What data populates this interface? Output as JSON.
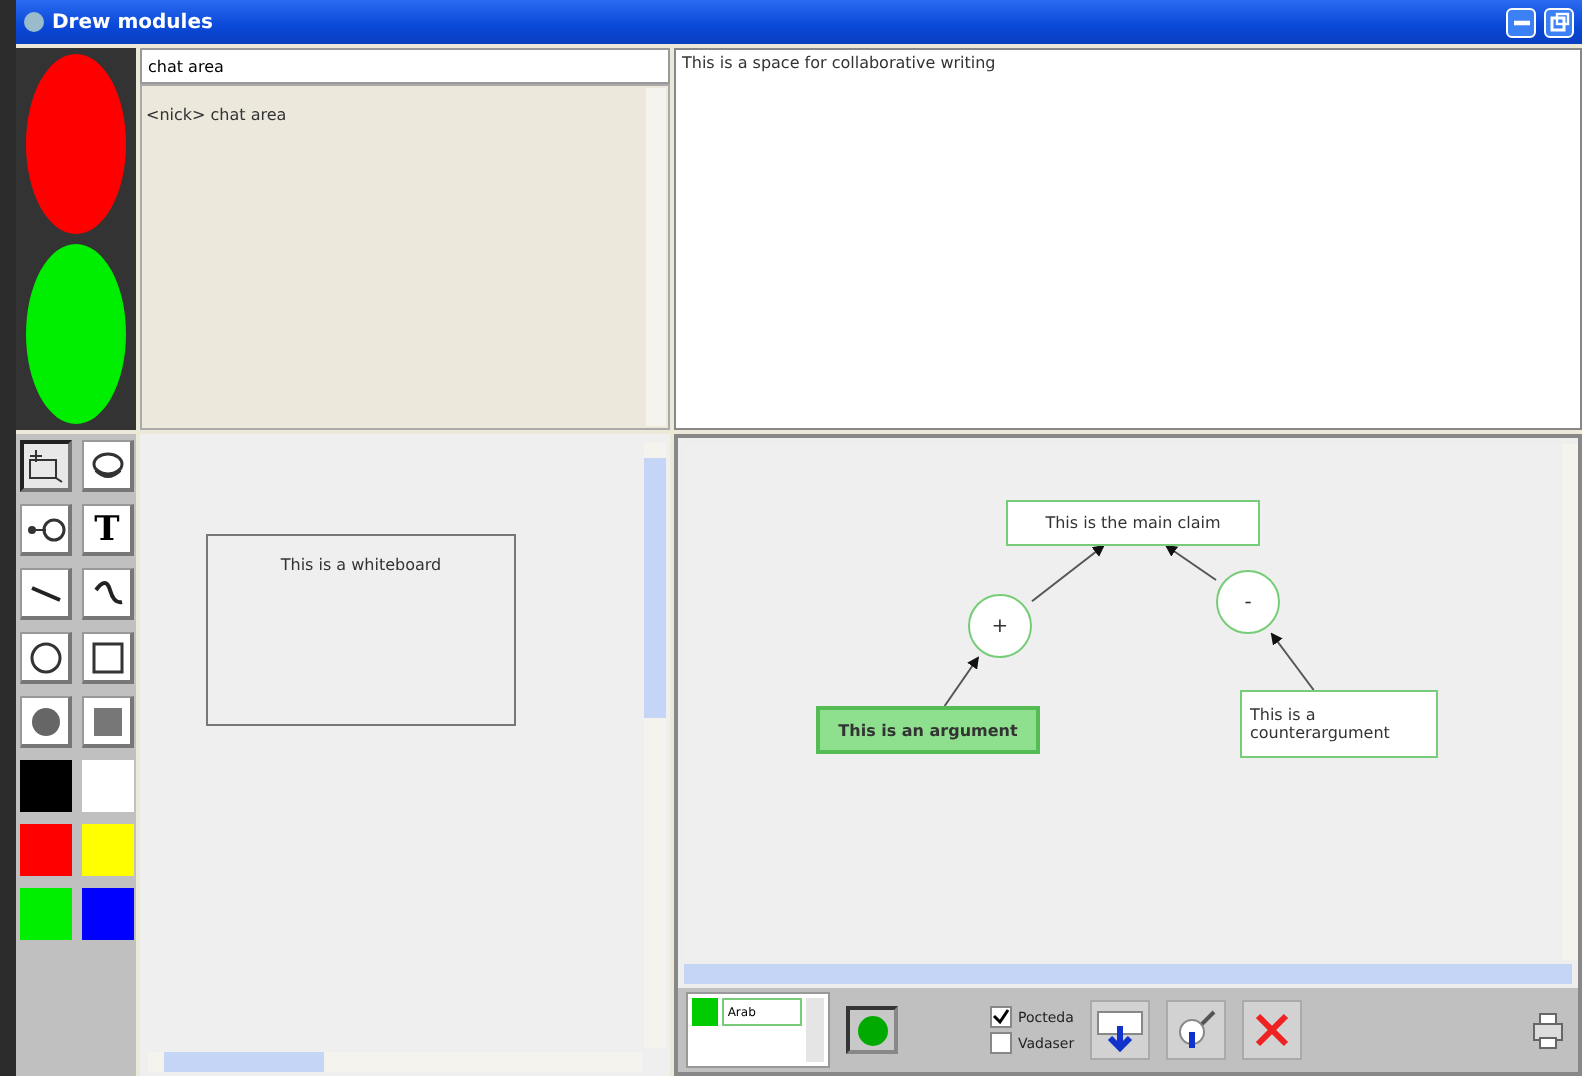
{
  "window": {
    "title": "Drew modules"
  },
  "status_lights": [
    {
      "color": "#ff0000"
    },
    {
      "color": "#00ee00"
    }
  ],
  "chat": {
    "input": "chat area",
    "log": "<nick> chat area"
  },
  "writing": {
    "text": "This is a space for collaborative writing"
  },
  "tools": [
    {
      "kind": "select",
      "selected": true
    },
    {
      "kind": "eraser",
      "selected": false
    },
    {
      "kind": "connect",
      "selected": false
    },
    {
      "kind": "text",
      "label": "T",
      "selected": false
    },
    {
      "kind": "line",
      "selected": false
    },
    {
      "kind": "freehand",
      "selected": false
    },
    {
      "kind": "circle",
      "selected": false
    },
    {
      "kind": "rect",
      "selected": false
    },
    {
      "kind": "filled-circle",
      "selected": false
    },
    {
      "kind": "filled-rect",
      "selected": false
    }
  ],
  "colors": [
    {
      "color": "#000000"
    },
    {
      "color": "#ffffff"
    },
    {
      "color": "#ff0000"
    },
    {
      "color": "#ffff00"
    },
    {
      "color": "#00ee00"
    },
    {
      "color": "#0000ff"
    }
  ],
  "whiteboard": {
    "note": "This is a whiteboard"
  },
  "graph": {
    "nodes": [
      {
        "kind": "claim",
        "text": "This is the main claim",
        "selected": false
      },
      {
        "kind": "relation",
        "text": "+",
        "selected": false
      },
      {
        "kind": "relation",
        "text": "-",
        "selected": false
      },
      {
        "kind": "argument",
        "text": "This is an argument",
        "selected": true
      },
      {
        "kind": "argument",
        "text": "This is a counterargument",
        "selected": false
      }
    ]
  },
  "toolbar": {
    "color": "#00cc00",
    "field": "Arab",
    "options": [
      {
        "label": "Pocteda",
        "checked": true
      },
      {
        "label": "Vadaser",
        "checked": false
      }
    ],
    "actions": [
      {
        "kind": "insert"
      },
      {
        "kind": "edit"
      },
      {
        "kind": "delete"
      }
    ]
  }
}
